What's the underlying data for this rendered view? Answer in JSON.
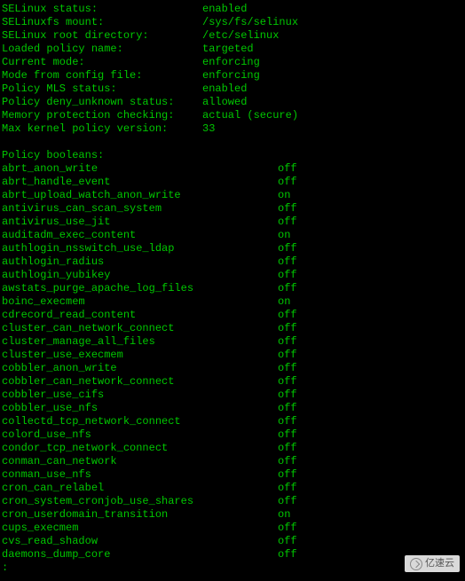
{
  "status": [
    {
      "label": "SELinux status:",
      "value": "enabled"
    },
    {
      "label": "SELinuxfs mount:",
      "value": "/sys/fs/selinux"
    },
    {
      "label": "SELinux root directory:",
      "value": "/etc/selinux"
    },
    {
      "label": "Loaded policy name:",
      "value": "targeted"
    },
    {
      "label": "Current mode:",
      "value": "enforcing"
    },
    {
      "label": "Mode from config file:",
      "value": "enforcing"
    },
    {
      "label": "Policy MLS status:",
      "value": "enabled"
    },
    {
      "label": "Policy deny_unknown status:",
      "value": "allowed"
    },
    {
      "label": "Memory protection checking:",
      "value": "actual (secure)"
    },
    {
      "label": "Max kernel policy version:",
      "value": "33"
    }
  ],
  "booleans_header": "Policy booleans:",
  "booleans": [
    {
      "name": "abrt_anon_write",
      "value": "off"
    },
    {
      "name": "abrt_handle_event",
      "value": "off"
    },
    {
      "name": "abrt_upload_watch_anon_write",
      "value": "on"
    },
    {
      "name": "antivirus_can_scan_system",
      "value": "off"
    },
    {
      "name": "antivirus_use_jit",
      "value": "off"
    },
    {
      "name": "auditadm_exec_content",
      "value": "on"
    },
    {
      "name": "authlogin_nsswitch_use_ldap",
      "value": "off"
    },
    {
      "name": "authlogin_radius",
      "value": "off"
    },
    {
      "name": "authlogin_yubikey",
      "value": "off"
    },
    {
      "name": "awstats_purge_apache_log_files",
      "value": "off"
    },
    {
      "name": "boinc_execmem",
      "value": "on"
    },
    {
      "name": "cdrecord_read_content",
      "value": "off"
    },
    {
      "name": "cluster_can_network_connect",
      "value": "off"
    },
    {
      "name": "cluster_manage_all_files",
      "value": "off"
    },
    {
      "name": "cluster_use_execmem",
      "value": "off"
    },
    {
      "name": "cobbler_anon_write",
      "value": "off"
    },
    {
      "name": "cobbler_can_network_connect",
      "value": "off"
    },
    {
      "name": "cobbler_use_cifs",
      "value": "off"
    },
    {
      "name": "cobbler_use_nfs",
      "value": "off"
    },
    {
      "name": "collectd_tcp_network_connect",
      "value": "off"
    },
    {
      "name": "colord_use_nfs",
      "value": "off"
    },
    {
      "name": "condor_tcp_network_connect",
      "value": "off"
    },
    {
      "name": "conman_can_network",
      "value": "off"
    },
    {
      "name": "conman_use_nfs",
      "value": "off"
    },
    {
      "name": "cron_can_relabel",
      "value": "off"
    },
    {
      "name": "cron_system_cronjob_use_shares",
      "value": "off"
    },
    {
      "name": "cron_userdomain_transition",
      "value": "on"
    },
    {
      "name": "cups_execmem",
      "value": "off"
    },
    {
      "name": "cvs_read_shadow",
      "value": "off"
    },
    {
      "name": "daemons_dump_core",
      "value": "off"
    }
  ],
  "prompt": ":",
  "watermark": "亿速云"
}
